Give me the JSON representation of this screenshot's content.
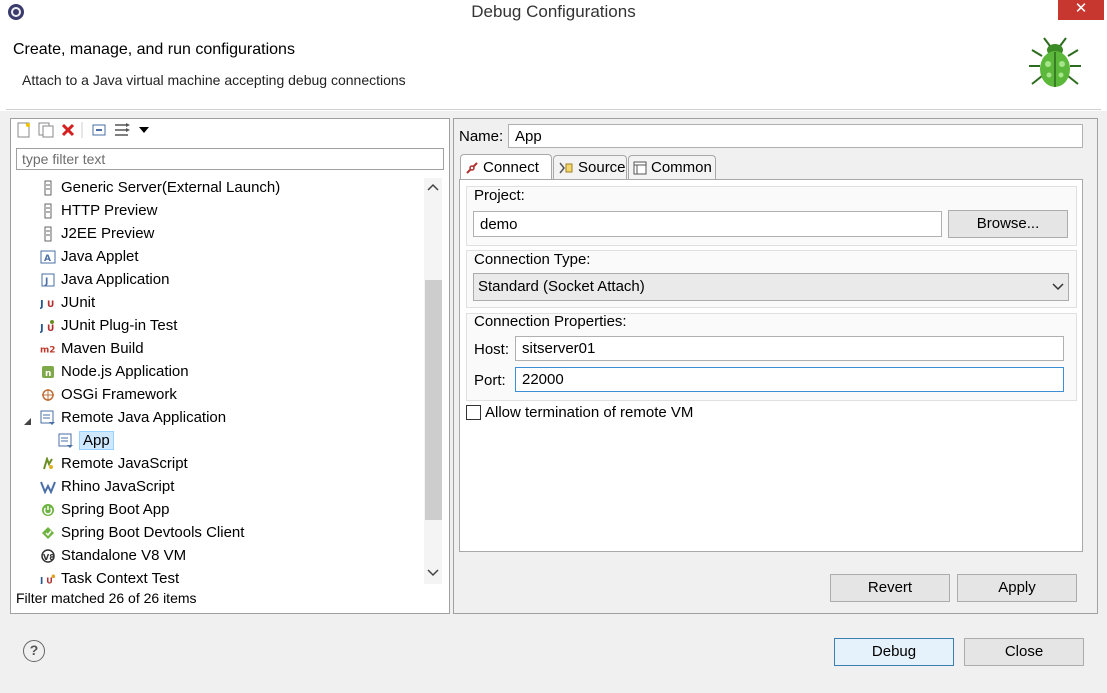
{
  "window": {
    "title": "Debug Configurations",
    "close_glyph": "✕"
  },
  "header": {
    "title": "Create, manage, and run configurations",
    "description": "Attach to a Java virtual machine accepting debug connections"
  },
  "left": {
    "filter_placeholder": "type filter text",
    "filter_status": "Filter matched 26 of 26 items",
    "toolbar_icons": [
      "new-config-icon",
      "duplicate-icon",
      "delete-icon",
      "collapse-all-icon",
      "filter-icon",
      "view-menu-icon"
    ],
    "tree_items": [
      {
        "label": "Generic Server(External Launch)",
        "icon": "server-icon",
        "indent": 0
      },
      {
        "label": "HTTP Preview",
        "icon": "server-icon",
        "indent": 0
      },
      {
        "label": "J2EE Preview",
        "icon": "server-icon",
        "indent": 0
      },
      {
        "label": "Java Applet",
        "icon": "java-applet-icon",
        "indent": 0
      },
      {
        "label": "Java Application",
        "icon": "java-app-icon",
        "indent": 0
      },
      {
        "label": "JUnit",
        "icon": "junit-icon",
        "indent": 0
      },
      {
        "label": "JUnit Plug-in Test",
        "icon": "junit-plugin-icon",
        "indent": 0
      },
      {
        "label": "Maven Build",
        "icon": "maven-icon",
        "indent": 0
      },
      {
        "label": "Node.js Application",
        "icon": "nodejs-icon",
        "indent": 0
      },
      {
        "label": "OSGi Framework",
        "icon": "osgi-icon",
        "indent": 0
      },
      {
        "label": "Remote Java Application",
        "icon": "remote-java-icon",
        "indent": 0,
        "expanded": true
      },
      {
        "label": "App",
        "icon": "remote-java-icon",
        "indent": 1,
        "selected": true
      },
      {
        "label": "Remote JavaScript",
        "icon": "remote-js-icon",
        "indent": 0
      },
      {
        "label": "Rhino JavaScript",
        "icon": "rhino-icon",
        "indent": 0
      },
      {
        "label": "Spring Boot App",
        "icon": "spring-boot-icon",
        "indent": 0
      },
      {
        "label": "Spring Boot Devtools Client",
        "icon": "spring-devtools-icon",
        "indent": 0
      },
      {
        "label": "Standalone V8 VM",
        "icon": "v8-icon",
        "indent": 0
      },
      {
        "label": "Task Context Test",
        "icon": "task-context-icon",
        "indent": 0
      }
    ]
  },
  "right": {
    "name_label": "Name:",
    "name_value": "App",
    "tabs": [
      {
        "label": "Connect",
        "active": true,
        "icon": "connect-icon"
      },
      {
        "label": "Source",
        "active": false,
        "icon": "source-icon"
      },
      {
        "label": "Common",
        "active": false,
        "icon": "common-icon"
      }
    ],
    "project_label": "Project:",
    "project_value": "demo",
    "browse_label": "Browse...",
    "connection_type_label": "Connection Type:",
    "connection_type_value": "Standard (Socket Attach)",
    "connection_props_label": "Connection Properties:",
    "host_label": "Host:",
    "host_value": "sitserver01",
    "port_label": "Port:",
    "port_value": "22000",
    "allow_termination_label": "Allow termination of remote VM",
    "allow_termination_checked": false,
    "revert_label": "Revert",
    "apply_label": "Apply"
  },
  "footer": {
    "help_glyph": "?",
    "debug_label": "Debug",
    "close_label": "Close"
  },
  "colors": {
    "close_button": "#c7372f",
    "selection": "#cde8ff",
    "default_button_border": "#3c7fb1"
  }
}
